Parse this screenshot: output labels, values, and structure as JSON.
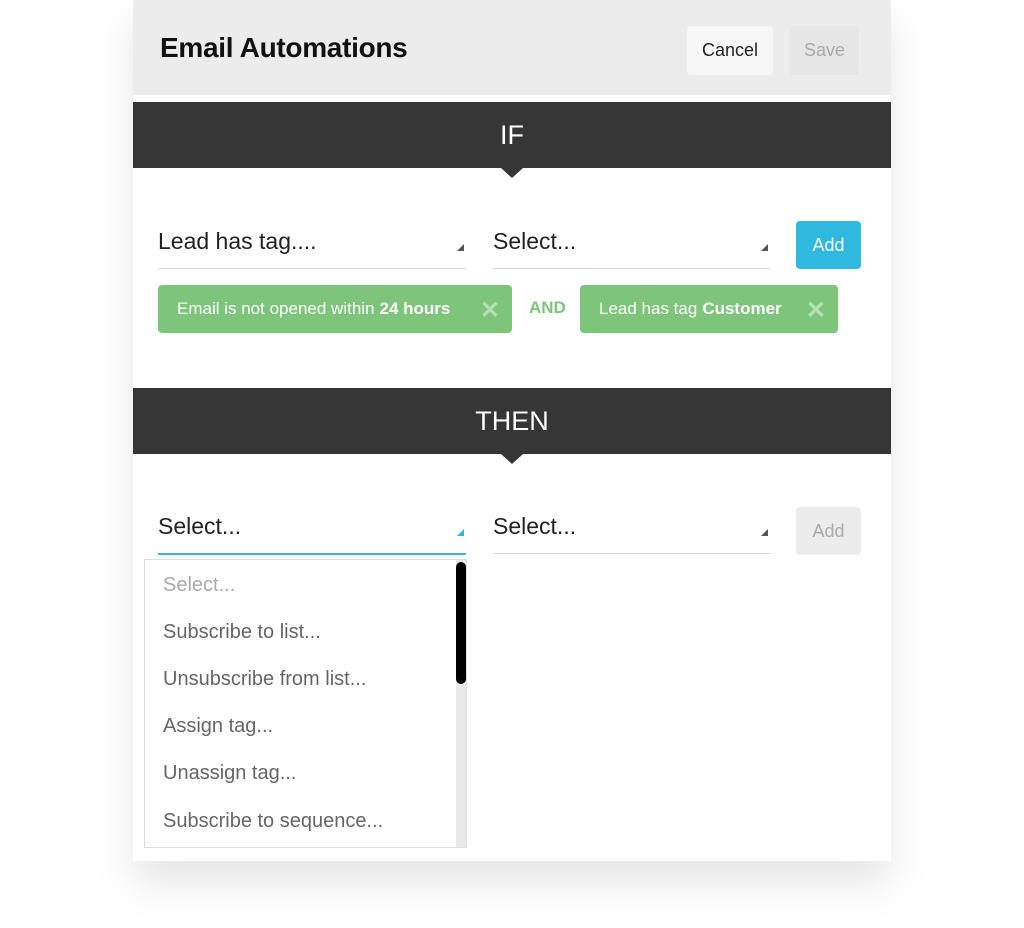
{
  "header": {
    "title": "Email Automations",
    "cancel_label": "Cancel",
    "save_label": "Save"
  },
  "if_section": {
    "label": "IF",
    "condition_select": "Lead has tag....",
    "value_select": "Select...",
    "add_label": "Add",
    "conditions": [
      {
        "text": "Email is not opened within",
        "bold": "24 hours",
        "remove": "✕"
      },
      {
        "text": "Lead has tag",
        "bold": "Customer",
        "remove": "✕"
      }
    ],
    "joiner": "AND"
  },
  "then_section": {
    "label": "THEN",
    "action_select": "Select...",
    "value_select": "Select...",
    "add_label": "Add",
    "dropdown_options": [
      "Select...",
      "Subscribe to list...",
      "Unsubscribe from list...",
      "Assign tag...",
      "Unassign tag...",
      "Subscribe to sequence..."
    ]
  },
  "colors": {
    "accent": "#2fb9de",
    "chip_green": "#7dc57a",
    "band_dark": "#363636"
  }
}
